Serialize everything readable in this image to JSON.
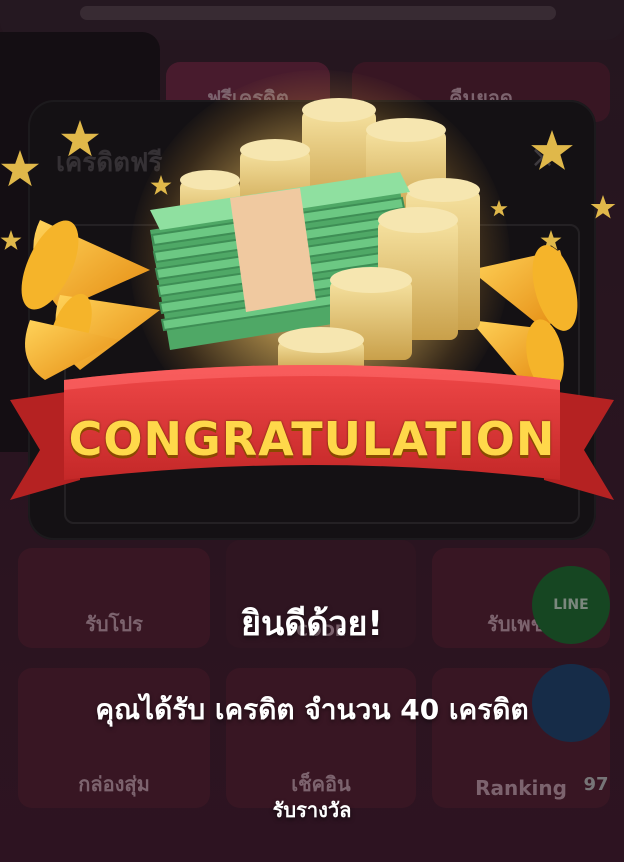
{
  "background": {
    "modal_title": "เครดิตฟรี",
    "close_glyph": "×",
    "tiles": {
      "top_left": "ฟรีเครดิต",
      "top_right": "คืนยอด",
      "promo": "รับโปร",
      "code": "CODE",
      "check_in": "เช็คอิน",
      "lucky": "กล่องสุ่ม",
      "ranking": "Ranking",
      "diamond": "รับเพชร"
    },
    "line_badge": "LINE",
    "badge_number": "97"
  },
  "reward": {
    "banner_text": "CONGRATULATION",
    "title": "ยินดีด้วย!",
    "message": "คุณได้รับ เครดิต จำนวน 40 เครดิต",
    "claim_label": "รับรางวัล"
  },
  "colors": {
    "banner_red": "#e53a3a",
    "banner_text": "#ffd84a",
    "cash_green": "#7fd48f",
    "coin_gold": "#e8c46a"
  },
  "icons": {
    "reward_art": "money-stack-with-coins-icon",
    "horns": "party-horn-icon",
    "stars": "star-icon"
  }
}
